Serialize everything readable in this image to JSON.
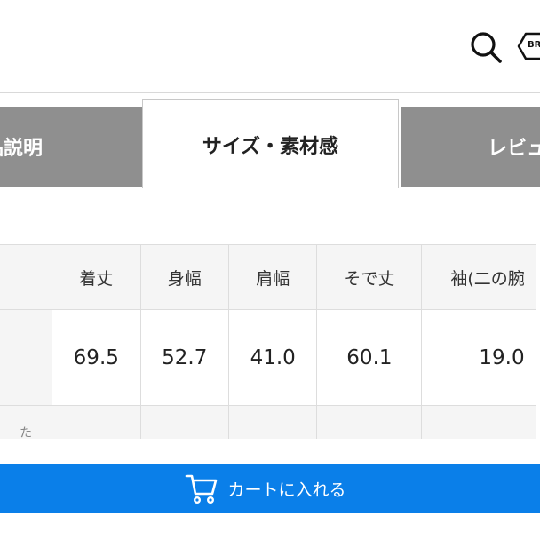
{
  "header": {
    "search_icon": "search-icon",
    "brand_label": "BRA"
  },
  "tabs": [
    {
      "label": "品説明",
      "active": false
    },
    {
      "label": "サイズ・素材感",
      "active": true
    },
    {
      "label": "レビュ",
      "active": false
    }
  ],
  "size_table": {
    "headers": [
      "",
      "着丈",
      "身幅",
      "肩幅",
      "そで丈",
      "袖(二の腕"
    ],
    "row_values": [
      "",
      "69.5",
      "52.7",
      "41.0",
      "60.1",
      "19.0"
    ],
    "row_extra": [
      "た",
      "",
      "",
      "",
      "",
      ""
    ]
  },
  "cart": {
    "label": "カートに入れる",
    "icon": "cart-icon"
  },
  "colors": {
    "tab_inactive": "#8f8f8f",
    "cart_blue": "#0a7fe9",
    "table_header_bg": "#f5f5f5"
  }
}
